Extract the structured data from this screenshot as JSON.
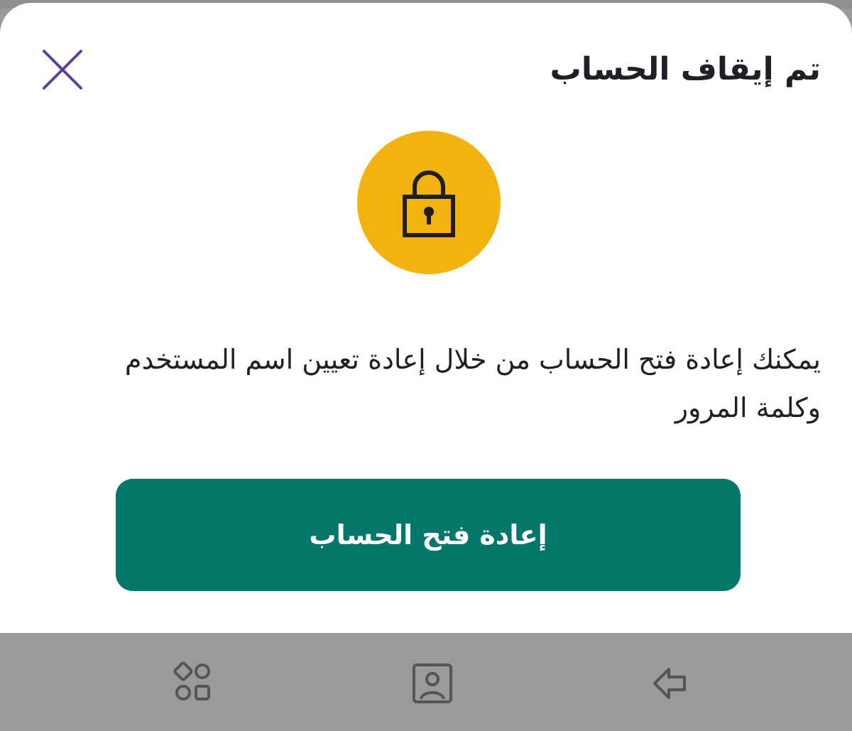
{
  "dialog": {
    "title": "تم إيقاف الحساب",
    "message": "يمكنك إعادة فتح الحساب من خلال إعادة تعيين اسم المستخدم وكلمة المرور",
    "primary_button_label": "إعادة فتح الحساب",
    "icon": "lock-icon",
    "close_icon": "close-icon"
  },
  "navbar": {
    "items": [
      {
        "icon": "apps-icon"
      },
      {
        "icon": "home-icon"
      },
      {
        "icon": "back-icon"
      }
    ]
  },
  "colors": {
    "accent_close": "#5b3ea0",
    "lock_circle": "#f4b20e",
    "primary_button": "#04766a",
    "text": "#1f1f28",
    "navbar": "#9a9a9a"
  }
}
